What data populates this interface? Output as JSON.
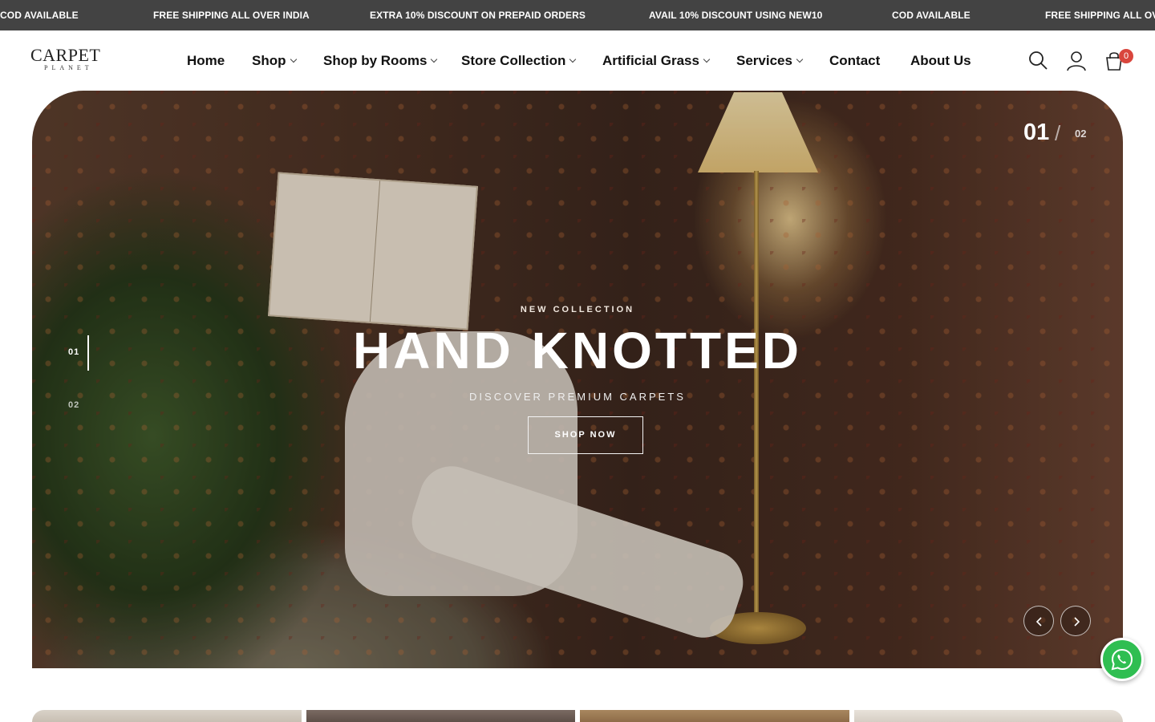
{
  "announcements": [
    "COD AVAILABLE",
    "FREE SHIPPING ALL OVER INDIA",
    "EXTRA 10% DISCOUNT ON PREPAID ORDERS",
    "AVAIL 10% DISCOUNT USING NEW10",
    "COD AVAILABLE",
    "FREE SHIPPING ALL OVER"
  ],
  "logo": {
    "line1": "CARPET",
    "line2": "PLANET"
  },
  "nav": [
    {
      "label": "Home"
    },
    {
      "label": "Shop"
    },
    {
      "label": "Shop by Rooms"
    },
    {
      "label": "Store Collection"
    },
    {
      "label": "Artificial Grass"
    },
    {
      "label": "Services"
    },
    {
      "label": "Contact"
    },
    {
      "label": "About Us"
    }
  ],
  "cart": {
    "count": "0"
  },
  "hero": {
    "counter_current": "01",
    "counter_sep": "/",
    "counter_total": "02",
    "dots": [
      "01",
      "02"
    ],
    "eyebrow": "NEW COLLECTION",
    "title": "HAND KNOTTED",
    "subtitle": "DISCOVER PREMIUM CARPETS",
    "cta": "SHOP NOW"
  },
  "colors": {
    "announce_bg": "#434343",
    "badge": "#d9463d",
    "whatsapp": "#2fbe51"
  },
  "icons": [
    "search-icon",
    "user-icon",
    "cart-icon",
    "chevron-left-icon",
    "chevron-right-icon",
    "whatsapp-icon"
  ]
}
